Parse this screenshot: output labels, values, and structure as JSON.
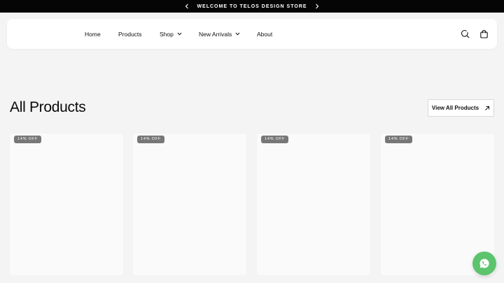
{
  "announcement": {
    "message": "WELCOME TO TELOS DESIGN STORE",
    "prev_icon": "chevron-left-icon",
    "next_icon": "chevron-right-icon"
  },
  "nav": {
    "items": [
      {
        "label": "Home",
        "has_dropdown": false
      },
      {
        "label": "Products",
        "has_dropdown": false
      },
      {
        "label": "Shop",
        "has_dropdown": true
      },
      {
        "label": "New Arrivals",
        "has_dropdown": true
      },
      {
        "label": "About",
        "has_dropdown": false
      }
    ],
    "icons": [
      "search-icon",
      "shopping-bag-icon"
    ]
  },
  "section": {
    "title": "All Products",
    "view_all_label": "View All Products",
    "view_all_icon": "arrow-up-right-icon"
  },
  "products": [
    {
      "badge": "14% OFF"
    },
    {
      "badge": "14% OFF"
    },
    {
      "badge": "14% OFF"
    },
    {
      "badge": "14% OFF"
    }
  ],
  "floating": {
    "icon": "whatsapp-icon",
    "color": "#5cc46d"
  },
  "colors": {
    "announcement_bg": "#050505",
    "page_bg": "#f4f4f4",
    "badge_bg": "#777777"
  }
}
